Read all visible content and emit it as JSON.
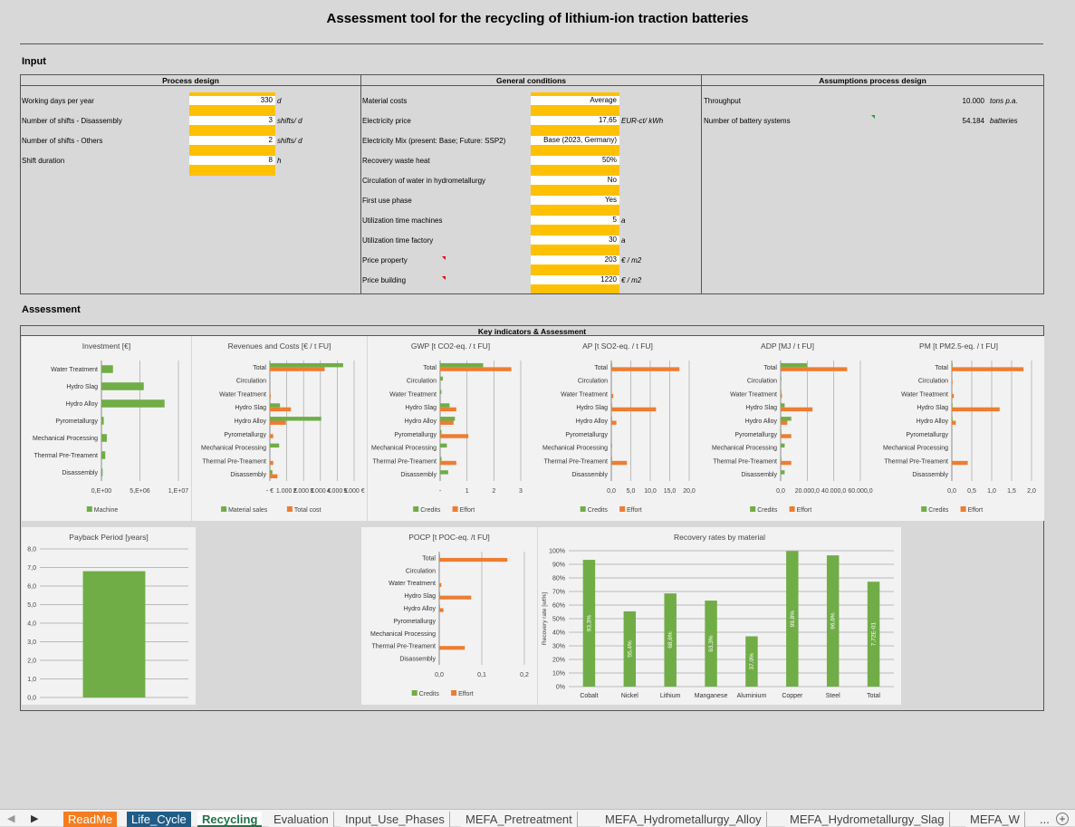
{
  "title": "Assessment tool for the recycling of lithium-ion traction batteries",
  "input_label": "Input",
  "assessment_label": "Assessment",
  "process_design": {
    "header": "Process design",
    "rows": [
      {
        "label": "Working days per year",
        "value": "330",
        "unit": "d"
      },
      {
        "label": "Number of shifts - Disassembly",
        "value": "3",
        "unit": "shifts/ d"
      },
      {
        "label": "Number of shifts - Others",
        "value": "2",
        "unit": "shifts/ d"
      },
      {
        "label": "Shift duration",
        "value": "8",
        "unit": "h"
      }
    ]
  },
  "general_conditions": {
    "header": "General conditions",
    "rows": [
      {
        "label": "Material costs",
        "value": "Average",
        "unit": ""
      },
      {
        "label": "Electricity price",
        "value": "17,65",
        "unit": "EUR-ct/ kWh"
      },
      {
        "label": "Electricity Mix (present: Base; Future: SSP2)",
        "value": "Base (2023, Germany)",
        "unit": ""
      },
      {
        "label": "Recovery waste heat",
        "value": "50%",
        "unit": ""
      },
      {
        "label": "Circulation of water in hydrometallurgy",
        "value": "No",
        "unit": ""
      },
      {
        "label": "First use phase",
        "value": "Yes",
        "unit": ""
      },
      {
        "label": "Utilization time machines",
        "value": "5",
        "unit": "a"
      },
      {
        "label": "Utilization time factory",
        "value": "30",
        "unit": "a"
      },
      {
        "label": "Price property",
        "value": "203",
        "unit": "€ / m2"
      },
      {
        "label": "Price building",
        "value": "1220",
        "unit": "€ / m2"
      }
    ]
  },
  "assumptions": {
    "header": "Assumptions process design",
    "rows": [
      {
        "label": "Throughput",
        "value": "10.000",
        "unit": "tons p.a."
      },
      {
        "label": "Number of battery systems",
        "value": "54.184",
        "unit": "batteries"
      }
    ]
  },
  "key_header": "Key indicators & Assessment",
  "colors": {
    "green": "#70ad47",
    "orange": "#ed7d31",
    "yellow": "#ffc000",
    "green_bar": "#5cb85c"
  },
  "chart_data": [
    {
      "type": "bar",
      "orientation": "horizontal",
      "title": "Investment [€]",
      "categories": [
        "Water Treatment",
        "Hydro Slag",
        "Hydro Alloy",
        "Pyrometallurgy",
        "Mechanical Processing",
        "Thermal Pre-Treament",
        "Disassembly"
      ],
      "series": [
        {
          "name": "Machine",
          "color": "#70ad47",
          "values": [
            1500000,
            5500000,
            8200000,
            300000,
            700000,
            500000,
            150000
          ]
        }
      ],
      "xlim": [
        0,
        10000000
      ],
      "ticks": [
        0,
        5000000,
        10000000
      ],
      "tick_labels": [
        "0,E+00",
        "5,E+06",
        "1,E+07"
      ]
    },
    {
      "type": "bar",
      "orientation": "horizontal",
      "title": "Revenues and Costs [€ / t FU]",
      "categories": [
        "Total",
        "Circulation",
        "Water Treatment",
        "Hydro Slag",
        "Hydro Alloy",
        "Pyrometallurgy",
        "Mechanical Processing",
        "Thermal Pre-Treament",
        "Disassembly"
      ],
      "series": [
        {
          "name": "Material sales",
          "color": "#70ad47",
          "values": [
            4350,
            0,
            0,
            600,
            3050,
            0,
            550,
            0,
            150
          ]
        },
        {
          "name": "Total cost",
          "color": "#ed7d31",
          "values": [
            3250,
            0,
            50,
            1250,
            950,
            200,
            0,
            200,
            450
          ]
        }
      ],
      "xlim": [
        0,
        5000
      ],
      "ticks": [
        0,
        1000,
        2000,
        3000,
        4000,
        5000
      ],
      "tick_labels": [
        "- €",
        "1.000 €",
        "2.000 €",
        "3.000 €",
        "4.000 €",
        "5.000 €"
      ]
    },
    {
      "type": "bar",
      "orientation": "horizontal",
      "title": "GWP [t CO2-eq. / t FU]",
      "categories": [
        "Total",
        "Circulation",
        "Water Treatment",
        "Hydro Slag",
        "Hydro Alloy",
        "Pyrometallurgy",
        "Mechanical Processing",
        "Thermal Pre-Treament",
        "Disassembly"
      ],
      "series": [
        {
          "name": "Credits",
          "color": "#70ad47",
          "values": [
            1.6,
            0.1,
            0.05,
            0.35,
            0.55,
            0.05,
            0.25,
            0.05,
            0.3
          ]
        },
        {
          "name": "Effort",
          "color": "#ed7d31",
          "values": [
            2.65,
            0,
            0,
            0.6,
            0.5,
            1.05,
            0,
            0.6,
            0
          ]
        }
      ],
      "xlim": [
        0,
        3
      ],
      "ticks": [
        0,
        1,
        2,
        3
      ],
      "tick_labels": [
        "-",
        "1",
        "2",
        "3"
      ]
    },
    {
      "type": "bar",
      "orientation": "horizontal",
      "title": "AP [t SO2-eq. / t FU]",
      "categories": [
        "Total",
        "Circulation",
        "Water Treatment",
        "Hydro Slag",
        "Hydro Alloy",
        "Pyrometallurgy",
        "Mechanical Processing",
        "Thermal Pre-Treament",
        "Disassembly"
      ],
      "series": [
        {
          "name": "Credits",
          "color": "#70ad47",
          "values": [
            0.2,
            0,
            0,
            0.1,
            0.1,
            0,
            0.1,
            0.1,
            0
          ]
        },
        {
          "name": "Effort",
          "color": "#ed7d31",
          "values": [
            17.5,
            0,
            0.5,
            11.5,
            1.3,
            0,
            0,
            4,
            0
          ]
        }
      ],
      "xlim": [
        0,
        20
      ],
      "ticks": [
        0,
        5,
        10,
        15,
        20
      ],
      "tick_labels": [
        "0,0",
        "5,0",
        "10,0",
        "15,0",
        "20,0"
      ]
    },
    {
      "type": "bar",
      "orientation": "horizontal",
      "title": "ADP [MJ / t FU]",
      "categories": [
        "Total",
        "Circulation",
        "Water Treatment",
        "Hydro Slag",
        "Hydro Alloy",
        "Pyrometallurgy",
        "Mechanical Processing",
        "Thermal Pre-Treament",
        "Disassembly"
      ],
      "series": [
        {
          "name": "Credits",
          "color": "#70ad47",
          "values": [
            20000,
            500,
            500,
            3000,
            8000,
            500,
            3000,
            500,
            3000
          ]
        },
        {
          "name": "Effort",
          "color": "#ed7d31",
          "values": [
            50000,
            0,
            1000,
            24000,
            5000,
            8000,
            0,
            8000,
            0
          ]
        }
      ],
      "xlim": [
        0,
        60000
      ],
      "ticks": [
        0,
        20000,
        40000,
        60000
      ],
      "tick_labels": [
        "0,0",
        "20.000,0",
        "40.000,0",
        "60.000,0"
      ]
    },
    {
      "type": "bar",
      "orientation": "horizontal",
      "title": "PM [t PM2.5-eq. / t FU]",
      "categories": [
        "Total",
        "Circulation",
        "Water Treatment",
        "Hydro Slag",
        "Hydro Alloy",
        "Pyrometallurgy",
        "Mechanical Processing",
        "Thermal Pre-Treament",
        "Disassembly"
      ],
      "series": [
        {
          "name": "Credits",
          "color": "#70ad47",
          "values": [
            0.01,
            0,
            0,
            0.01,
            0.01,
            0,
            0,
            0,
            0
          ]
        },
        {
          "name": "Effort",
          "color": "#ed7d31",
          "values": [
            1.8,
            0.01,
            0.05,
            1.2,
            0.1,
            0,
            0,
            0.4,
            0
          ]
        }
      ],
      "xlim": [
        0,
        2
      ],
      "ticks": [
        0,
        0.5,
        1,
        1.5,
        2
      ],
      "tick_labels": [
        "0,0",
        "0,5",
        "1,0",
        "1,5",
        "2,0"
      ]
    },
    {
      "type": "bar",
      "orientation": "vertical",
      "title": "Payback Period [years]",
      "categories": [
        ""
      ],
      "series": [
        {
          "name": "",
          "color": "#70ad47",
          "values": [
            6.8
          ]
        }
      ],
      "ylim": [
        0,
        8
      ],
      "ticks": [
        0,
        1,
        2,
        3,
        4,
        5,
        6,
        7,
        8
      ],
      "tick_labels": [
        "0,0",
        "1,0",
        "2,0",
        "3,0",
        "4,0",
        "5,0",
        "6,0",
        "7,0",
        "8,0"
      ]
    },
    {
      "type": "bar",
      "orientation": "horizontal",
      "title": "POCP [t POC-eq. /t FU]",
      "categories": [
        "Total",
        "Circulation",
        "Water Treatment",
        "Hydro Slag",
        "Hydro Alloy",
        "Pyrometallurgy",
        "Mechanical Processing",
        "Thermal Pre-Treament",
        "Disassembly"
      ],
      "series": [
        {
          "name": "Credits",
          "color": "#70ad47",
          "values": [
            0.001,
            0,
            0,
            0.001,
            0.001,
            0,
            0,
            0,
            0
          ]
        },
        {
          "name": "Effort",
          "color": "#ed7d31",
          "values": [
            0.16,
            0,
            0.005,
            0.075,
            0.01,
            0,
            0,
            0.06,
            0
          ]
        }
      ],
      "xlim": [
        0,
        0.2
      ],
      "ticks": [
        0,
        0.1,
        0.2
      ],
      "tick_labels": [
        "0,0",
        "0,1",
        "0,2"
      ]
    },
    {
      "type": "bar",
      "orientation": "vertical",
      "title": "Recovery rates by material",
      "categories": [
        "Cobalt",
        "Nickel",
        "Lithium",
        "Manganese",
        "Aluminium",
        "Copper",
        "Steel",
        "Total"
      ],
      "series": [
        {
          "name": "",
          "color": "#70ad47",
          "values": [
            93.3,
            55.4,
            68.6,
            63.3,
            37.0,
            99.8,
            96.6,
            77.2
          ],
          "labels": [
            "93,3%",
            "55,4%",
            "68,6%",
            "63,3%",
            "37,0%",
            "99,8%",
            "96,6%",
            "7,72E-01"
          ]
        }
      ],
      "ylabel": "Recovery rate [wt%]",
      "ylim": [
        0,
        100
      ],
      "ticks": [
        0,
        10,
        20,
        30,
        40,
        50,
        60,
        70,
        80,
        90,
        100
      ],
      "tick_labels": [
        "0%",
        "10%",
        "20%",
        "30%",
        "40%",
        "50%",
        "60%",
        "70%",
        "80%",
        "90%",
        "100%"
      ]
    }
  ],
  "tabs": [
    {
      "label": "ReadMe",
      "bg": "#f47d1f",
      "fg": "#ffffff"
    },
    {
      "label": "Life_Cycle",
      "bg": "#1f5c87",
      "fg": "#ffffff"
    },
    {
      "label": "Recycling",
      "bg": "#ffffff",
      "fg": "#217346",
      "active": true
    },
    {
      "label": "Evaluation",
      "bg": "#f3f3f3",
      "fg": "#444444"
    },
    {
      "label": "Input_Use_Phases",
      "bg": "#f3f3f3",
      "fg": "#444444"
    },
    {
      "label": "MEFA_Pretreatment",
      "bg": "#f3f3f3",
      "fg": "#444444"
    },
    {
      "label": "MEFA_Hydrometallurgy_Alloy",
      "bg": "#f3f3f3",
      "fg": "#444444"
    },
    {
      "label": "MEFA_Hydrometallurgy_Slag",
      "bg": "#f3f3f3",
      "fg": "#444444"
    },
    {
      "label": "MEFA_W",
      "bg": "#f3f3f3",
      "fg": "#444444"
    }
  ],
  "tab_more": "...",
  "add_sheet": "+"
}
